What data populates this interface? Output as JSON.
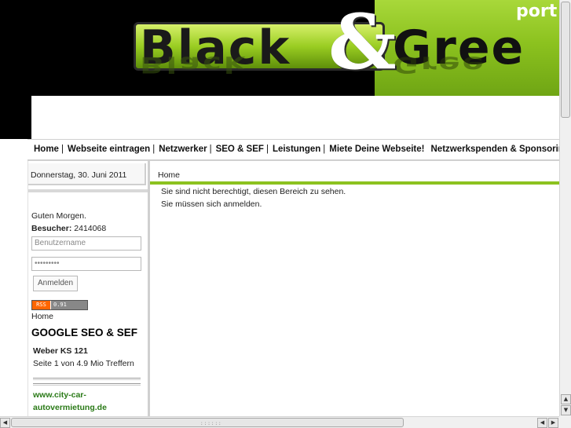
{
  "header": {
    "logo_word1": "Black",
    "logo_amp": "&",
    "logo_word2": "Gree",
    "logo_port": "port",
    "colors": {
      "accent": "#8cc21f",
      "background": "#000000"
    }
  },
  "nav": {
    "items": [
      {
        "label": "Home"
      },
      {
        "label": "Webseite eintragen"
      },
      {
        "label": "Netzwerker"
      },
      {
        "label": "SEO & SEF"
      },
      {
        "label": "Leistungen"
      },
      {
        "label": "Miete Deine Webseite!"
      },
      {
        "label": "Netzwerkspenden & Sponsoring"
      }
    ],
    "separator": "|"
  },
  "sidebar": {
    "date": "Donnerstag, 30. Juni 2011",
    "greeting": "Guten Morgen.",
    "visitors_label": "Besucher:",
    "visitors_count": "2414068",
    "username_placeholder": "Benutzername",
    "password_value": "•••••••••",
    "login_label": "Anmelden",
    "rss_left": "RSS",
    "rss_right": "0.91",
    "home_link": "Home",
    "heading": "GOOGLE SEO & SEF",
    "seo_title": "Weber KS 121",
    "seo_result": "Seite 1 von 4.9 Mio Treffern",
    "link_line1": "www.city-car-",
    "link_line2": "autovermietung.de"
  },
  "content": {
    "breadcrumb": "Home",
    "message_line1": "Sie sind nicht berechtigt, diesen Bereich zu sehen.",
    "message_line2": "Sie müssen sich anmelden."
  }
}
